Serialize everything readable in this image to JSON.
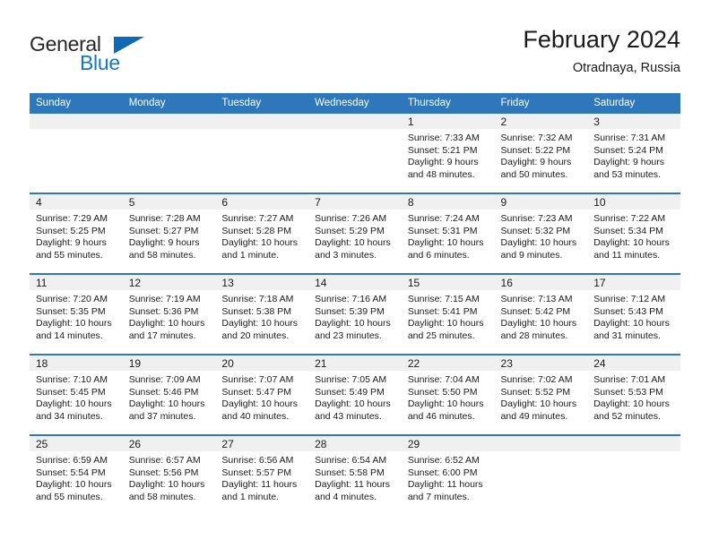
{
  "brand": {
    "name_top": "General",
    "name_bottom": "Blue",
    "triangle_icon": "triangle-icon",
    "accent_color": "#1069b4"
  },
  "header": {
    "title": "February 2024",
    "subtitle": "Otradnaya, Russia"
  },
  "calendar": {
    "header_bg": "#2e77bb",
    "daynum_bg": "#f0f0f0",
    "weekdays": [
      "Sunday",
      "Monday",
      "Tuesday",
      "Wednesday",
      "Thursday",
      "Friday",
      "Saturday"
    ],
    "weeks": [
      [
        {
          "day": "",
          "empty": true,
          "lines": []
        },
        {
          "day": "",
          "empty": true,
          "lines": []
        },
        {
          "day": "",
          "empty": true,
          "lines": []
        },
        {
          "day": "",
          "empty": true,
          "lines": []
        },
        {
          "day": "1",
          "lines": [
            "Sunrise: 7:33 AM",
            "Sunset: 5:21 PM",
            "Daylight: 9 hours",
            "and 48 minutes."
          ]
        },
        {
          "day": "2",
          "lines": [
            "Sunrise: 7:32 AM",
            "Sunset: 5:22 PM",
            "Daylight: 9 hours",
            "and 50 minutes."
          ]
        },
        {
          "day": "3",
          "lines": [
            "Sunrise: 7:31 AM",
            "Sunset: 5:24 PM",
            "Daylight: 9 hours",
            "and 53 minutes."
          ]
        }
      ],
      [
        {
          "day": "4",
          "lines": [
            "Sunrise: 7:29 AM",
            "Sunset: 5:25 PM",
            "Daylight: 9 hours",
            "and 55 minutes."
          ]
        },
        {
          "day": "5",
          "lines": [
            "Sunrise: 7:28 AM",
            "Sunset: 5:27 PM",
            "Daylight: 9 hours",
            "and 58 minutes."
          ]
        },
        {
          "day": "6",
          "lines": [
            "Sunrise: 7:27 AM",
            "Sunset: 5:28 PM",
            "Daylight: 10 hours",
            "and 1 minute."
          ]
        },
        {
          "day": "7",
          "lines": [
            "Sunrise: 7:26 AM",
            "Sunset: 5:29 PM",
            "Daylight: 10 hours",
            "and 3 minutes."
          ]
        },
        {
          "day": "8",
          "lines": [
            "Sunrise: 7:24 AM",
            "Sunset: 5:31 PM",
            "Daylight: 10 hours",
            "and 6 minutes."
          ]
        },
        {
          "day": "9",
          "lines": [
            "Sunrise: 7:23 AM",
            "Sunset: 5:32 PM",
            "Daylight: 10 hours",
            "and 9 minutes."
          ]
        },
        {
          "day": "10",
          "lines": [
            "Sunrise: 7:22 AM",
            "Sunset: 5:34 PM",
            "Daylight: 10 hours",
            "and 11 minutes."
          ]
        }
      ],
      [
        {
          "day": "11",
          "lines": [
            "Sunrise: 7:20 AM",
            "Sunset: 5:35 PM",
            "Daylight: 10 hours",
            "and 14 minutes."
          ]
        },
        {
          "day": "12",
          "lines": [
            "Sunrise: 7:19 AM",
            "Sunset: 5:36 PM",
            "Daylight: 10 hours",
            "and 17 minutes."
          ]
        },
        {
          "day": "13",
          "lines": [
            "Sunrise: 7:18 AM",
            "Sunset: 5:38 PM",
            "Daylight: 10 hours",
            "and 20 minutes."
          ]
        },
        {
          "day": "14",
          "lines": [
            "Sunrise: 7:16 AM",
            "Sunset: 5:39 PM",
            "Daylight: 10 hours",
            "and 23 minutes."
          ]
        },
        {
          "day": "15",
          "lines": [
            "Sunrise: 7:15 AM",
            "Sunset: 5:41 PM",
            "Daylight: 10 hours",
            "and 25 minutes."
          ]
        },
        {
          "day": "16",
          "lines": [
            "Sunrise: 7:13 AM",
            "Sunset: 5:42 PM",
            "Daylight: 10 hours",
            "and 28 minutes."
          ]
        },
        {
          "day": "17",
          "lines": [
            "Sunrise: 7:12 AM",
            "Sunset: 5:43 PM",
            "Daylight: 10 hours",
            "and 31 minutes."
          ]
        }
      ],
      [
        {
          "day": "18",
          "lines": [
            "Sunrise: 7:10 AM",
            "Sunset: 5:45 PM",
            "Daylight: 10 hours",
            "and 34 minutes."
          ]
        },
        {
          "day": "19",
          "lines": [
            "Sunrise: 7:09 AM",
            "Sunset: 5:46 PM",
            "Daylight: 10 hours",
            "and 37 minutes."
          ]
        },
        {
          "day": "20",
          "lines": [
            "Sunrise: 7:07 AM",
            "Sunset: 5:47 PM",
            "Daylight: 10 hours",
            "and 40 minutes."
          ]
        },
        {
          "day": "21",
          "lines": [
            "Sunrise: 7:05 AM",
            "Sunset: 5:49 PM",
            "Daylight: 10 hours",
            "and 43 minutes."
          ]
        },
        {
          "day": "22",
          "lines": [
            "Sunrise: 7:04 AM",
            "Sunset: 5:50 PM",
            "Daylight: 10 hours",
            "and 46 minutes."
          ]
        },
        {
          "day": "23",
          "lines": [
            "Sunrise: 7:02 AM",
            "Sunset: 5:52 PM",
            "Daylight: 10 hours",
            "and 49 minutes."
          ]
        },
        {
          "day": "24",
          "lines": [
            "Sunrise: 7:01 AM",
            "Sunset: 5:53 PM",
            "Daylight: 10 hours",
            "and 52 minutes."
          ]
        }
      ],
      [
        {
          "day": "25",
          "lines": [
            "Sunrise: 6:59 AM",
            "Sunset: 5:54 PM",
            "Daylight: 10 hours",
            "and 55 minutes."
          ]
        },
        {
          "day": "26",
          "lines": [
            "Sunrise: 6:57 AM",
            "Sunset: 5:56 PM",
            "Daylight: 10 hours",
            "and 58 minutes."
          ]
        },
        {
          "day": "27",
          "lines": [
            "Sunrise: 6:56 AM",
            "Sunset: 5:57 PM",
            "Daylight: 11 hours",
            "and 1 minute."
          ]
        },
        {
          "day": "28",
          "lines": [
            "Sunrise: 6:54 AM",
            "Sunset: 5:58 PM",
            "Daylight: 11 hours",
            "and 4 minutes."
          ]
        },
        {
          "day": "29",
          "lines": [
            "Sunrise: 6:52 AM",
            "Sunset: 6:00 PM",
            "Daylight: 11 hours",
            "and 7 minutes."
          ]
        },
        {
          "day": "",
          "empty": true,
          "lines": []
        },
        {
          "day": "",
          "empty": true,
          "lines": []
        }
      ]
    ]
  }
}
